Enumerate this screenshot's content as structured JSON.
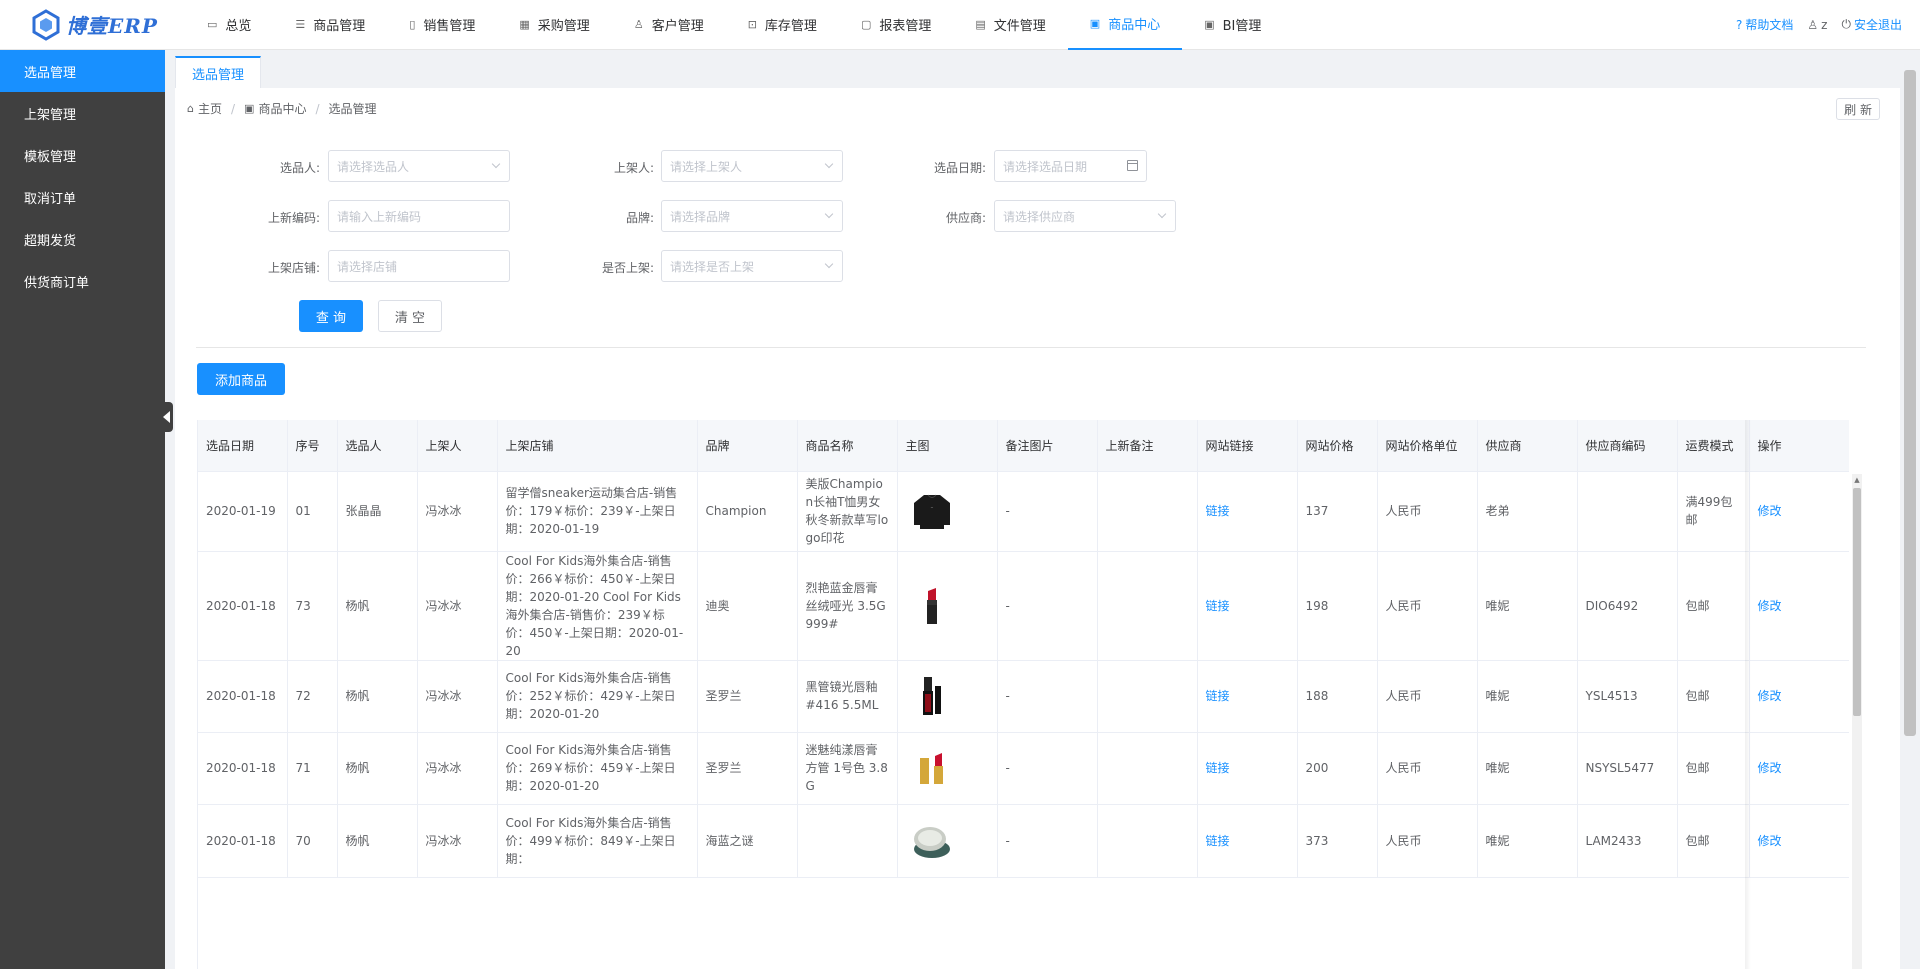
{
  "brand": {
    "logo_text": "博壹ERP"
  },
  "nav": [
    {
      "label": "总览",
      "icon": "monitor-icon"
    },
    {
      "label": "商品管理",
      "icon": "list-icon"
    },
    {
      "label": "销售管理",
      "icon": "save-icon"
    },
    {
      "label": "采购管理",
      "icon": "grid-icon"
    },
    {
      "label": "客户管理",
      "icon": "user-icon"
    },
    {
      "label": "库存管理",
      "icon": "cart-icon"
    },
    {
      "label": "报表管理",
      "icon": "document-icon"
    },
    {
      "label": "文件管理",
      "icon": "notebook-icon"
    },
    {
      "label": "商品中心",
      "icon": "tickets-icon",
      "active": true
    },
    {
      "label": "BI管理",
      "icon": "tickets-icon"
    }
  ],
  "top_right": {
    "help": "帮助文档",
    "user": "z",
    "logout": "安全退出"
  },
  "sidebar": [
    {
      "label": "选品管理",
      "active": true
    },
    {
      "label": "上架管理"
    },
    {
      "label": "模板管理"
    },
    {
      "label": "取消订单"
    },
    {
      "label": "超期发货"
    },
    {
      "label": "供货商订单"
    }
  ],
  "tab": {
    "label": "选品管理"
  },
  "breadcrumb": {
    "home": "主页",
    "center": "商品中心",
    "current": "选品管理"
  },
  "refresh_label": "刷 新",
  "form": {
    "selector_label": "选品人:",
    "selector_ph": "请选择选品人",
    "lister_label": "上架人:",
    "lister_ph": "请选择上架人",
    "date_label": "选品日期:",
    "date_ph": "请选择选品日期",
    "code_label": "上新编码:",
    "code_ph": "请输入上新编码",
    "brand_label": "品牌:",
    "brand_ph": "请选择品牌",
    "supplier_label": "供应商:",
    "supplier_ph": "请选择供应商",
    "store_label": "上架店铺:",
    "store_ph": "请选择店铺",
    "listed_label": "是否上架:",
    "listed_ph": "请选择是否上架",
    "query_label": "查 询",
    "clear_label": "清 空"
  },
  "add_button_label": "添加商品",
  "table": {
    "headers": [
      "选品日期",
      "序号",
      "选品人",
      "上架人",
      "上架店铺",
      "品牌",
      "商品名称",
      "主图",
      "备注图片",
      "上新备注",
      "网站链接",
      "网站价格",
      "网站价格单位",
      "供应商",
      "供应商编码",
      "运费模式",
      "操作"
    ],
    "link_label": "链接",
    "edit_label": "修改",
    "rows": [
      {
        "date": "2020-01-19",
        "no": "01",
        "selector": "张晶晶",
        "lister": "冯冰冰",
        "store": "留学僧sneaker运动集合店-销售价：179￥标价：239￥-上架日期：2020-01-19",
        "brand": "Champion",
        "name": "美版Champion长袖T恤男女秋冬新款草写logo印花",
        "img": "sweatshirt",
        "remark_img": "-",
        "note": "",
        "price": "137",
        "unit": "人民币",
        "supplier": "老弟",
        "supplier_code": "",
        "shipping": "满499包邮"
      },
      {
        "date": "2020-01-18",
        "no": "73",
        "selector": "杨帆",
        "lister": "冯冰冰",
        "store": "Cool For Kids海外集合店-销售价：266￥标价：450￥-上架日期：2020-01-20 Cool For Kids海外集合店-销售价：239￥标价：450￥-上架日期：2020-01-20",
        "brand": "迪奥",
        "name": "烈艳蓝金唇膏丝绒哑光 3.5G 999#",
        "img": "lipstick",
        "remark_img": "-",
        "note": "",
        "price": "198",
        "unit": "人民币",
        "supplier": "唯妮",
        "supplier_code": "DIO6492",
        "shipping": "包邮"
      },
      {
        "date": "2020-01-18",
        "no": "72",
        "selector": "杨帆",
        "lister": "冯冰冰",
        "store": "Cool For Kids海外集合店-销售价：252￥标价：429￥-上架日期：2020-01-20",
        "brand": "圣罗兰",
        "name": "黑管镜光唇釉 #416 5.5ML",
        "img": "lipgloss",
        "remark_img": "-",
        "note": "",
        "price": "188",
        "unit": "人民币",
        "supplier": "唯妮",
        "supplier_code": "YSL4513",
        "shipping": "包邮"
      },
      {
        "date": "2020-01-18",
        "no": "71",
        "selector": "杨帆",
        "lister": "冯冰冰",
        "store": "Cool For Kids海外集合店-销售价：269￥标价：459￥-上架日期：2020-01-20",
        "brand": "圣罗兰",
        "name": "迷魅纯漾唇膏方管 1号色 3.8G",
        "img": "goldlipstick",
        "remark_img": "-",
        "note": "",
        "price": "200",
        "unit": "人民币",
        "supplier": "唯妮",
        "supplier_code": "NSYSL5477",
        "shipping": "包邮"
      },
      {
        "date": "2020-01-18",
        "no": "70",
        "selector": "杨帆",
        "lister": "冯冰冰",
        "store": "Cool For Kids海外集合店-销售价：499￥标价：849￥-上架日期：",
        "brand": "海蓝之谜",
        "name": "",
        "img": "cream",
        "remark_img": "-",
        "note": "",
        "price": "373",
        "unit": "人民币",
        "supplier": "唯妮",
        "supplier_code": "LAM2433",
        "shipping": "包邮"
      }
    ]
  }
}
